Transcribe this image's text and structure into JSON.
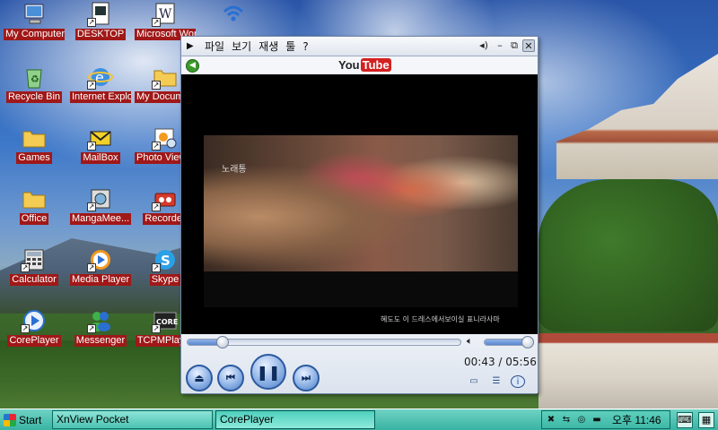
{
  "desktop": {
    "icons": [
      {
        "id": "my-computer",
        "label": "My Computer",
        "icon": "my-computer-icon"
      },
      {
        "id": "desktop",
        "label": "DESKTOP",
        "icon": "desktop-file-icon"
      },
      {
        "id": "microsoft-wordpad",
        "label": "Microsoft WordPad",
        "icon": "wordpad-icon"
      },
      {
        "id": "wifi",
        "label": "Wi-Fi",
        "icon": "wifi-icon"
      },
      {
        "id": "recycle-bin",
        "label": "Recycle Bin",
        "icon": "recycle-bin-icon"
      },
      {
        "id": "internet-explorer",
        "label": "Internet Explorer",
        "icon": "internet-explorer-icon"
      },
      {
        "id": "my-documents",
        "label": "My Documents",
        "icon": "folder-icon"
      },
      {
        "id": "games",
        "label": "Games",
        "icon": "folder-icon"
      },
      {
        "id": "mailbox",
        "label": "MailBox",
        "icon": "mail-icon"
      },
      {
        "id": "photo-viewer",
        "label": "Photo Viewer",
        "icon": "photo-viewer-icon"
      },
      {
        "id": "office",
        "label": "Office",
        "icon": "folder-icon"
      },
      {
        "id": "mangameeya",
        "label": "MangaMee...",
        "icon": "manga-viewer-icon"
      },
      {
        "id": "recorder",
        "label": "Recorder",
        "icon": "recorder-icon"
      },
      {
        "id": "calculator",
        "label": "Calculator",
        "icon": "calculator-icon"
      },
      {
        "id": "media-player",
        "label": "Media Player",
        "icon": "media-player-icon"
      },
      {
        "id": "skype",
        "label": "Skype",
        "icon": "skype-icon"
      },
      {
        "id": "coreplayer",
        "label": "CorePlayer",
        "icon": "coreplayer-icon"
      },
      {
        "id": "messenger",
        "label": "Messenger",
        "icon": "messenger-icon"
      },
      {
        "id": "tcpmp",
        "label": "TCPMPlayer",
        "icon": "tcpmp-icon"
      }
    ]
  },
  "player": {
    "menu": [
      "파일",
      "보기",
      "재생",
      "툴",
      "?"
    ],
    "youtube": {
      "you": "You",
      "tube": "Tube"
    },
    "video": {
      "caption_top": "노래통",
      "caption_bottom": "혜도도  이 드레스에서보이실 표니라사마"
    },
    "seek_progress": 0.128,
    "volume_level": 0.85,
    "time": "00:43 / 05:56"
  },
  "taskbar": {
    "start": "Start",
    "tasks": [
      "XnView Pocket",
      "CorePlayer"
    ],
    "clock": "오후 11:46"
  },
  "colors": {
    "label_bg": "#a01818",
    "taskbar": "#39b3a3",
    "player_frame": "#e8eef7"
  }
}
